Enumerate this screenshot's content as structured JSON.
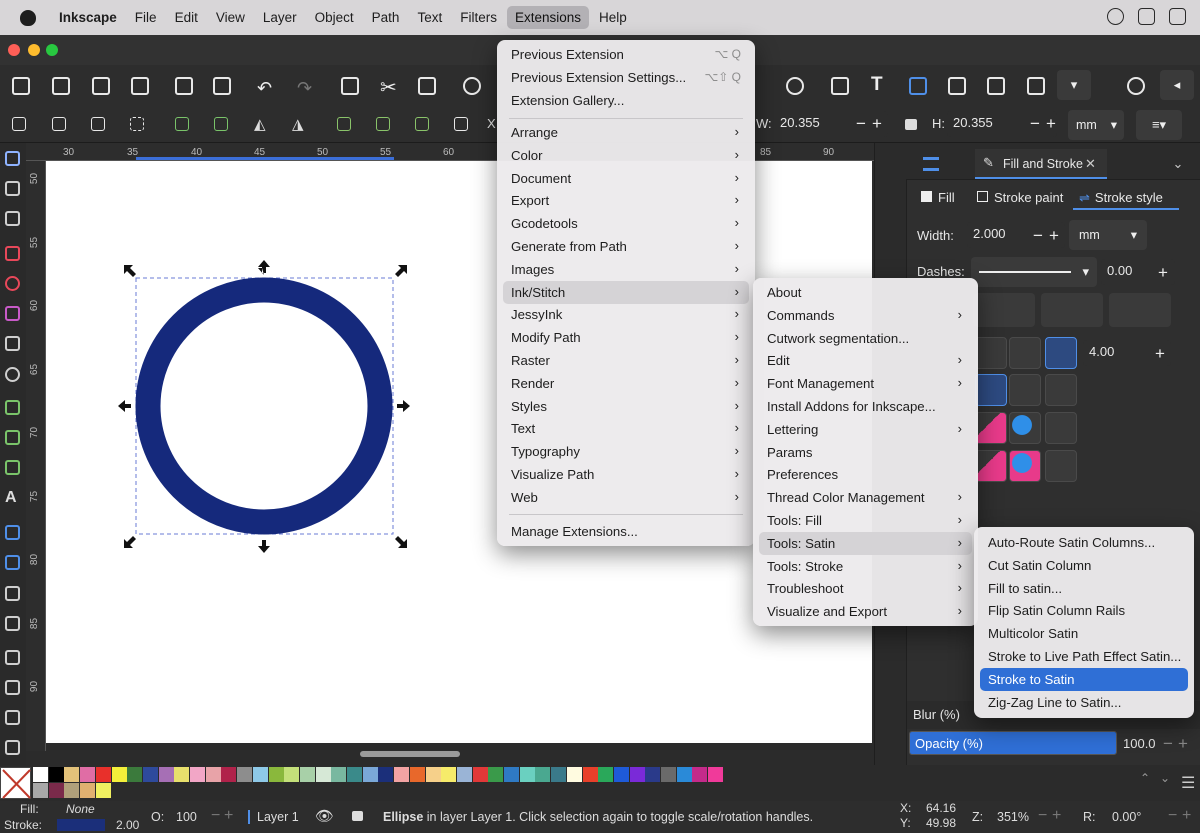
{
  "menubar": {
    "items": [
      "Inkscape",
      "File",
      "Edit",
      "View",
      "Layer",
      "Object",
      "Path",
      "Text",
      "Filters",
      "Extensions",
      "Help"
    ],
    "active": "Extensions"
  },
  "toolbar": {
    "w_label": "W:",
    "w_value": "20.355",
    "h_label": "H:",
    "h_value": "20.355",
    "unit": "mm"
  },
  "ruler": {
    "top": [
      "30",
      "35",
      "40",
      "45",
      "50",
      "55",
      "60",
      "85",
      "90"
    ],
    "left": [
      "50",
      "55",
      "60",
      "65",
      "70",
      "75",
      "80",
      "85",
      "90"
    ]
  },
  "panel": {
    "tab_label": "Fill and Stroke",
    "subtabs": [
      "Fill",
      "Stroke paint",
      "Stroke style"
    ],
    "width_label": "Width:",
    "width_value": "2.000",
    "width_unit": "mm",
    "dashes_label": "Dashes:",
    "dashes_value": "0.00",
    "miter_value": "4.00",
    "blur_label": "Blur (%)",
    "opacity_label": "Opacity (%)",
    "opacity_value": "100.0",
    "opacity_level": 100
  },
  "extensions_menu": {
    "top": [
      {
        "label": "Previous Extension",
        "shortcut": "⌥ Q"
      },
      {
        "label": "Previous Extension Settings...",
        "shortcut": "⌥⇧ Q"
      },
      {
        "label": "Extension Gallery...",
        "shortcut": ""
      }
    ],
    "groups": [
      "Arrange",
      "Color",
      "Document",
      "Export",
      "Gcodetools",
      "Generate from Path",
      "Images",
      "Ink/Stitch",
      "JessyInk",
      "Modify Path",
      "Raster",
      "Render",
      "Styles",
      "Text",
      "Typography",
      "Visualize Path",
      "Web"
    ],
    "highlighted": "Ink/Stitch",
    "manage": "Manage Extensions..."
  },
  "inkstitch_menu": {
    "items": [
      {
        "label": "About",
        "sub": false
      },
      {
        "label": "Commands",
        "sub": true
      },
      {
        "label": "Cutwork segmentation...",
        "sub": false
      },
      {
        "label": "Edit",
        "sub": true
      },
      {
        "label": "Font Management",
        "sub": true
      },
      {
        "label": "Install Addons for Inkscape...",
        "sub": false
      },
      {
        "label": "Lettering",
        "sub": true
      },
      {
        "label": "Params",
        "sub": false
      },
      {
        "label": "Preferences",
        "sub": false
      },
      {
        "label": "Thread Color Management",
        "sub": true
      },
      {
        "label": "Tools: Fill",
        "sub": true
      },
      {
        "label": "Tools: Satin",
        "sub": true
      },
      {
        "label": "Tools: Stroke",
        "sub": true
      },
      {
        "label": "Troubleshoot",
        "sub": true
      },
      {
        "label": "Visualize and Export",
        "sub": true
      }
    ],
    "highlighted": "Tools: Satin"
  },
  "satin_menu": {
    "items": [
      "Auto-Route Satin Columns...",
      "Cut Satin Column",
      "Fill to satin...",
      "Flip Satin Column Rails",
      "Multicolor Satin",
      "Stroke to Live Path Effect Satin...",
      "Stroke to Satin",
      "Zig-Zag Line to Satin..."
    ],
    "selected": "Stroke to Satin"
  },
  "palette": [
    "#ffffff",
    "#000000",
    "#e3c27a",
    "#e06da5",
    "#e8302b",
    "#f3ef3a",
    "#3b7a3c",
    "#2e4a9c",
    "#a66fb5",
    "#e8e06c",
    "#f2a6c6",
    "#e8a3a8",
    "#b0224a",
    "#8d8d8d",
    "#8ec9e8",
    "#8ab83c",
    "#c4e07a",
    "#a8d0a8",
    "#d6e8d6",
    "#79b8a0",
    "#3a8a8a",
    "#7aa8d8",
    "#1b2f7a",
    "#f3a3a3",
    "#e8682b",
    "#f6d08a",
    "#f6eb6a",
    "#9ab4d6",
    "#e13838",
    "#3a9a4a",
    "#2f7ac4",
    "#6ad0c0",
    "#4aa890",
    "#3a7a8a",
    "#fffbe0",
    "#e8402a",
    "#2aa85a",
    "#1e5ad8",
    "#7a2ad8",
    "#2a3a8a",
    "#6a6a6a",
    "#2a8ad8",
    "#c42a8a",
    "#f03a9a"
  ],
  "palette2": [
    "#a8a8a8",
    "#7a2a4a",
    "#b0a07a",
    "#e0b070",
    "#f0f060"
  ],
  "status": {
    "fill_label": "Fill:",
    "fill_value": "None",
    "stroke_label": "Stroke:",
    "stroke_width": "2.00",
    "stroke_color": "#1b2f7a",
    "o_label": "O:",
    "o_value": "100",
    "layer": "Layer 1",
    "msg_bold": "Ellipse",
    "msg_rest": " in layer Layer 1. Click selection again to toggle scale/rotation handles.",
    "x_label": "X:",
    "x_value": "64.16",
    "y_label": "Y:",
    "y_value": "49.98",
    "z_label": "Z:",
    "z_value": "351%",
    "r_label": "R:",
    "r_value": "0.00°"
  },
  "canvas": {
    "ring_color": "#15297c"
  }
}
